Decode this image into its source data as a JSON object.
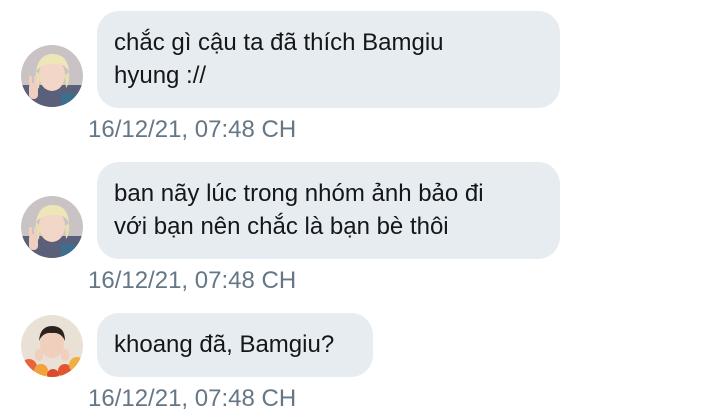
{
  "messages": [
    {
      "avatar": "blonde-boy-avatar",
      "lines": [
        "chắc gì cậu ta đã thích Bamgiu",
        "hyung ://"
      ],
      "timestamp": "16/12/21, 07:48 CH"
    },
    {
      "avatar": "blonde-boy-avatar",
      "lines": [
        "ban nãy lúc trong nhóm ảnh bảo đi",
        "với bạn nên chắc là bạn bè thôi"
      ],
      "timestamp": "16/12/21, 07:48 CH"
    },
    {
      "avatar": "dark-hair-boy-flowers-avatar",
      "lines": [
        "khoang đã, Bamgiu?"
      ],
      "timestamp": "16/12/21, 07:48 CH"
    }
  ],
  "colors": {
    "bubble": "#e6ecf0",
    "text": "#14171a",
    "timestamp": "#657786"
  }
}
